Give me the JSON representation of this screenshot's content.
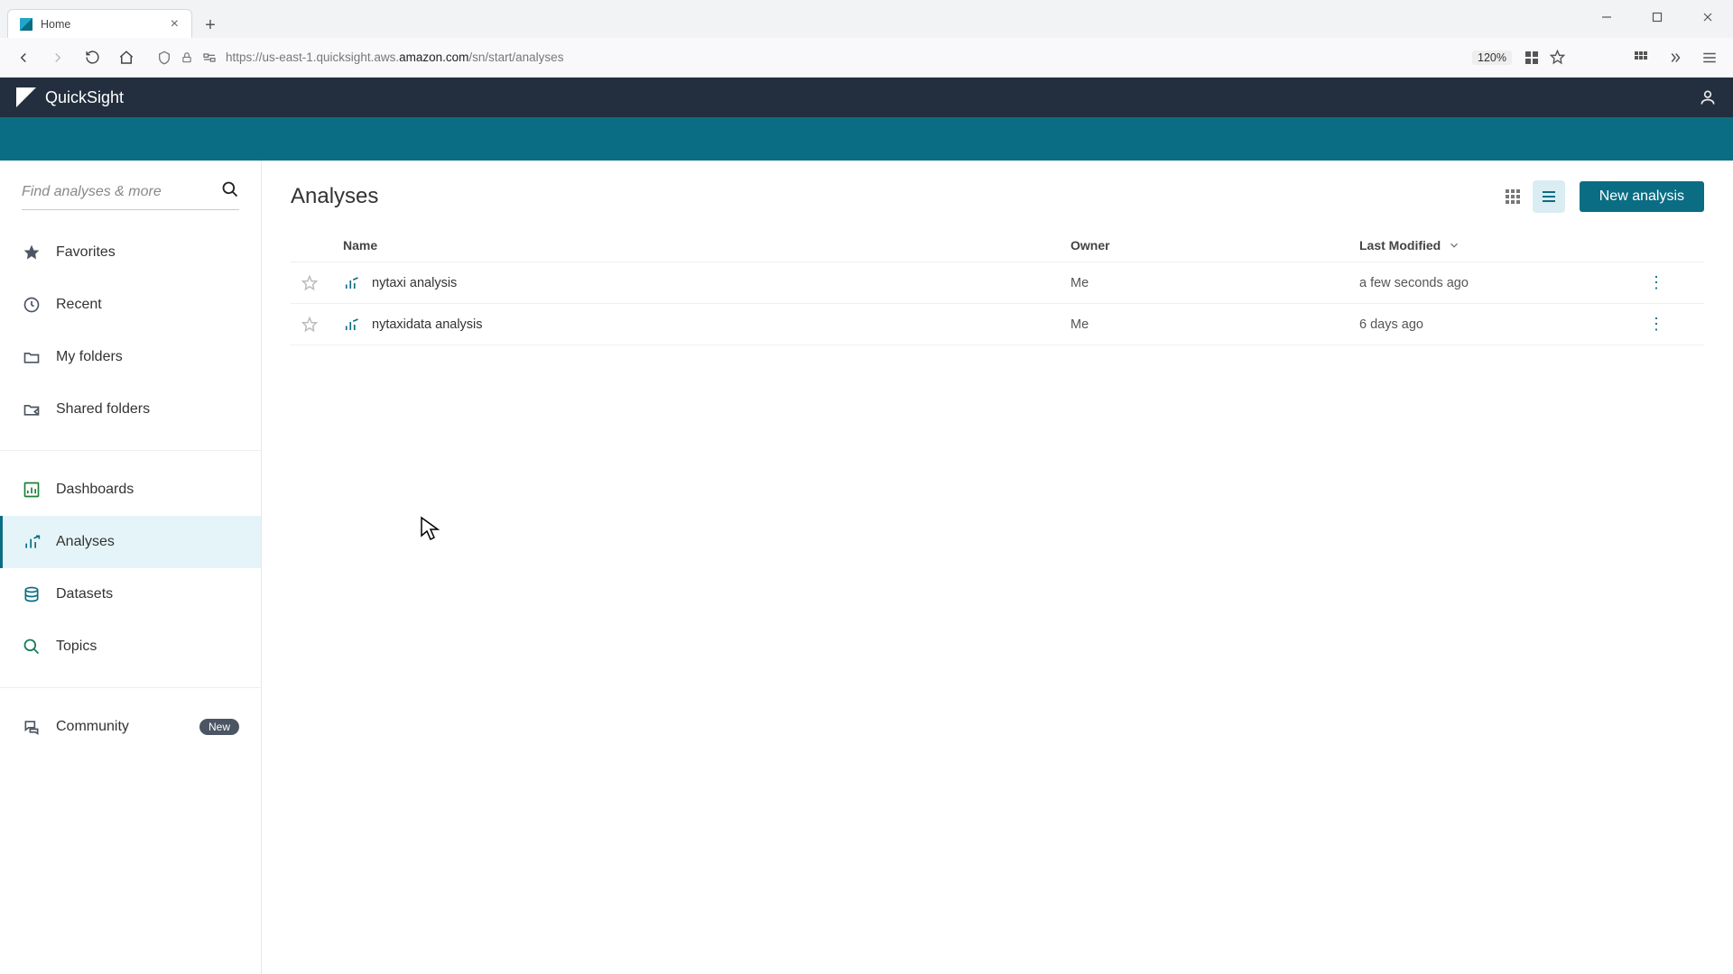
{
  "browser": {
    "tab_title": "Home",
    "url_prefix": "https://us-east-1.quicksight.aws.",
    "url_host": "amazon.com",
    "url_suffix": "/sn/start/analyses",
    "zoom": "120%"
  },
  "header": {
    "brand": "QuickSight"
  },
  "sidebar": {
    "search_placeholder": "Find analyses & more",
    "items": [
      {
        "label": "Favorites"
      },
      {
        "label": "Recent"
      },
      {
        "label": "My folders"
      },
      {
        "label": "Shared folders"
      },
      {
        "label": "Dashboards"
      },
      {
        "label": "Analyses"
      },
      {
        "label": "Datasets"
      },
      {
        "label": "Topics"
      },
      {
        "label": "Community",
        "badge": "New"
      }
    ]
  },
  "main": {
    "title": "Analyses",
    "new_button": "New analysis",
    "columns": {
      "name": "Name",
      "owner": "Owner",
      "modified": "Last Modified"
    },
    "rows": [
      {
        "name": "nytaxi analysis",
        "owner": "Me",
        "modified": "a few seconds ago"
      },
      {
        "name": "nytaxidata analysis",
        "owner": "Me",
        "modified": "6 days ago"
      }
    ]
  }
}
